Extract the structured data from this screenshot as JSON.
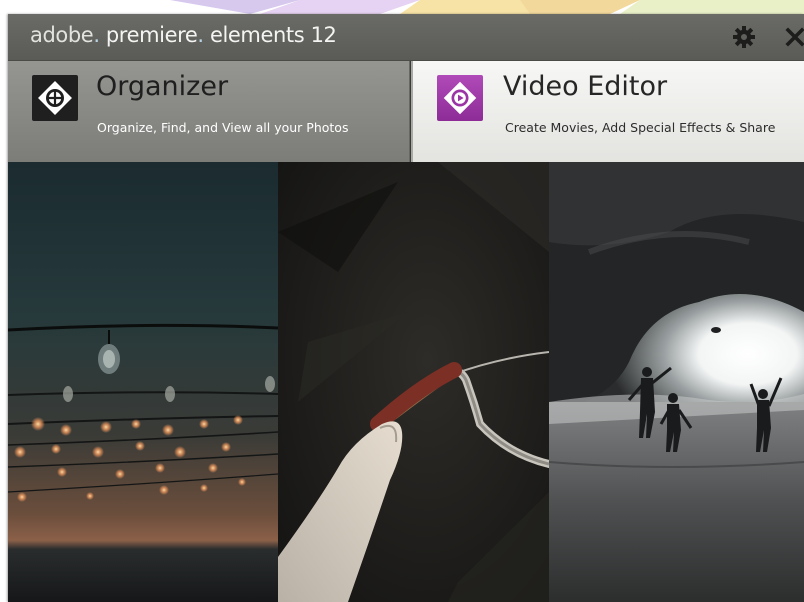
{
  "window": {
    "title_brand": "adobe",
    "title_dot": ".",
    "title_product": " premiere",
    "title_dot2": ".",
    "title_suffix": " elements 12"
  },
  "titlebar": {
    "settings_icon": "gear-icon",
    "close_icon": "close-icon"
  },
  "tabs": [
    {
      "label": "Organizer",
      "subtitle": "Organize, Find, and View all your Photos",
      "icon": "organizer-icon",
      "selected": false
    },
    {
      "label": "Video Editor",
      "subtitle": "Create Movies, Add Special Effects & Share",
      "icon": "video-editor-icon",
      "selected": true
    }
  ],
  "photos": [
    {
      "subject": "string-lights-at-dusk"
    },
    {
      "subject": "hand-on-bicycle-handlebar"
    },
    {
      "subject": "children-playing-in-sea-cave"
    }
  ],
  "colors": {
    "titlebar": "#5f605c",
    "organizer_tab": "#858581",
    "video_tab": "#ededeb",
    "video_icon": "#9b35a5"
  }
}
